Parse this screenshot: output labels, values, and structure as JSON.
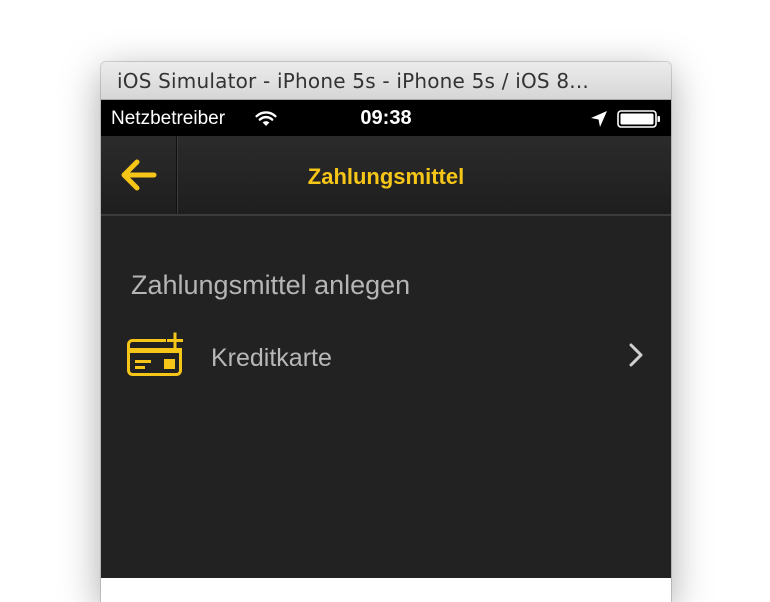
{
  "window": {
    "title": "iOS Simulator - iPhone 5s - iPhone 5s / iOS 8..."
  },
  "statusbar": {
    "carrier": "Netzbetreiber",
    "time": "09:38"
  },
  "navbar": {
    "title": "Zahlungsmittel"
  },
  "content": {
    "section_header": "Zahlungsmittel anlegen",
    "items": [
      {
        "label": "Kreditkarte",
        "icon": "credit-card-add-icon"
      }
    ]
  },
  "colors": {
    "accent": "#f5c518",
    "background": "#222222",
    "statusbar": "#000000",
    "text_secondary": "#b5b5b5"
  },
  "icons": {
    "back": "arrow-left-icon",
    "wifi": "wifi-icon",
    "location": "location-arrow-icon",
    "battery": "battery-icon",
    "disclosure": "chevron-right-icon"
  }
}
